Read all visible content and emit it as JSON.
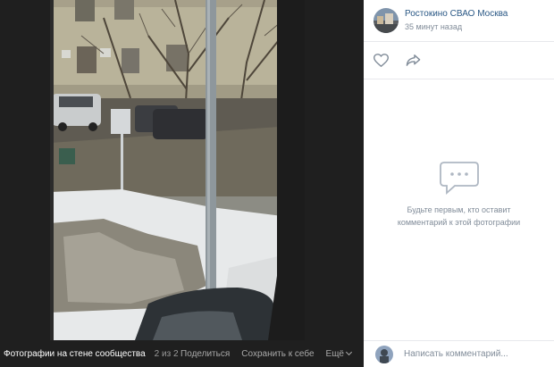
{
  "viewer": {
    "album_title": "Фотографии на стене сообщества",
    "counter": "2 из 2",
    "share_label": "Поделиться",
    "save_label": "Сохранить к себе",
    "more_label": "Ещё"
  },
  "post": {
    "group_name": "Ростокино СВАО Москва",
    "time": "35 минут назад"
  },
  "comments": {
    "empty_line1": "Будьте первым, кто оставит",
    "empty_line2": "комментарий к этой фотографии",
    "input_placeholder": "Написать комментарий..."
  },
  "icons": {
    "like": "heart-outline-icon",
    "share": "share-arrow-icon",
    "empty": "comment-bubble-icon"
  },
  "colors": {
    "link": "#2a5885",
    "muted": "#818c99",
    "viewer_bg": "#1f1f1f"
  }
}
